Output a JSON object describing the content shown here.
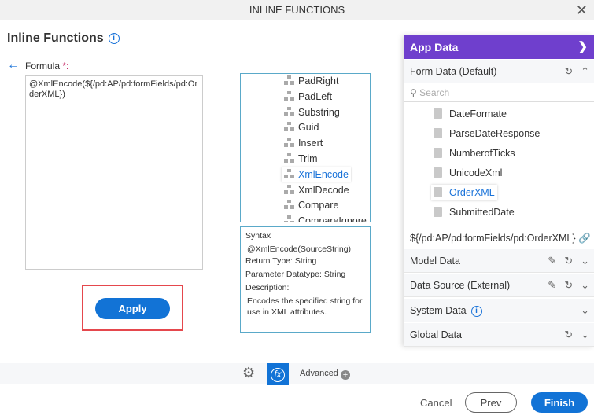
{
  "window": {
    "title": "INLINE FUNCTIONS",
    "close": "✕"
  },
  "heading": "Inline Functions",
  "formula": {
    "label": "Formula",
    "required": "*:",
    "value": "@XmlEncode(${/pd:AP/pd:formFields/pd:OrderXML})"
  },
  "apply_label": "Apply",
  "functions": [
    "PadRight",
    "PadLeft",
    "Substring",
    "Guid",
    "Insert",
    "Trim",
    "XmlEncode",
    "XmlDecode",
    "Compare",
    "CompareIgnore..."
  ],
  "selected_function": "XmlEncode",
  "syntax": {
    "title": "Syntax",
    "signature": "@XmlEncode(SourceString)",
    "return_label": "Return Type:",
    "return_value": "String",
    "param_label": "Parameter Datatype:",
    "param_value": "String",
    "desc_label": "Description:",
    "description": "Encodes the specified string for use in XML attributes."
  },
  "app_data": {
    "title": "App Data",
    "form_data": "Form Data (Default)",
    "search_placeholder": "Search",
    "items": [
      "DateFormate",
      "ParseDateResponse",
      "NumberofTicks",
      "UnicodeXml",
      "OrderXML",
      "SubmittedDate"
    ],
    "selected_item": "OrderXML",
    "path": "${/pd:AP/pd:formFields/pd:OrderXML}",
    "sections": [
      "Model Data",
      "Data Source (External)",
      "System Data",
      "Global Data"
    ]
  },
  "footer": {
    "advanced": "Advanced",
    "fx": "fx",
    "cancel": "Cancel",
    "prev": "Prev",
    "finish": "Finish"
  },
  "colors": {
    "accent": "#1273d6",
    "panel_header": "#6f3fcd",
    "highlight_border": "#e5484d"
  }
}
